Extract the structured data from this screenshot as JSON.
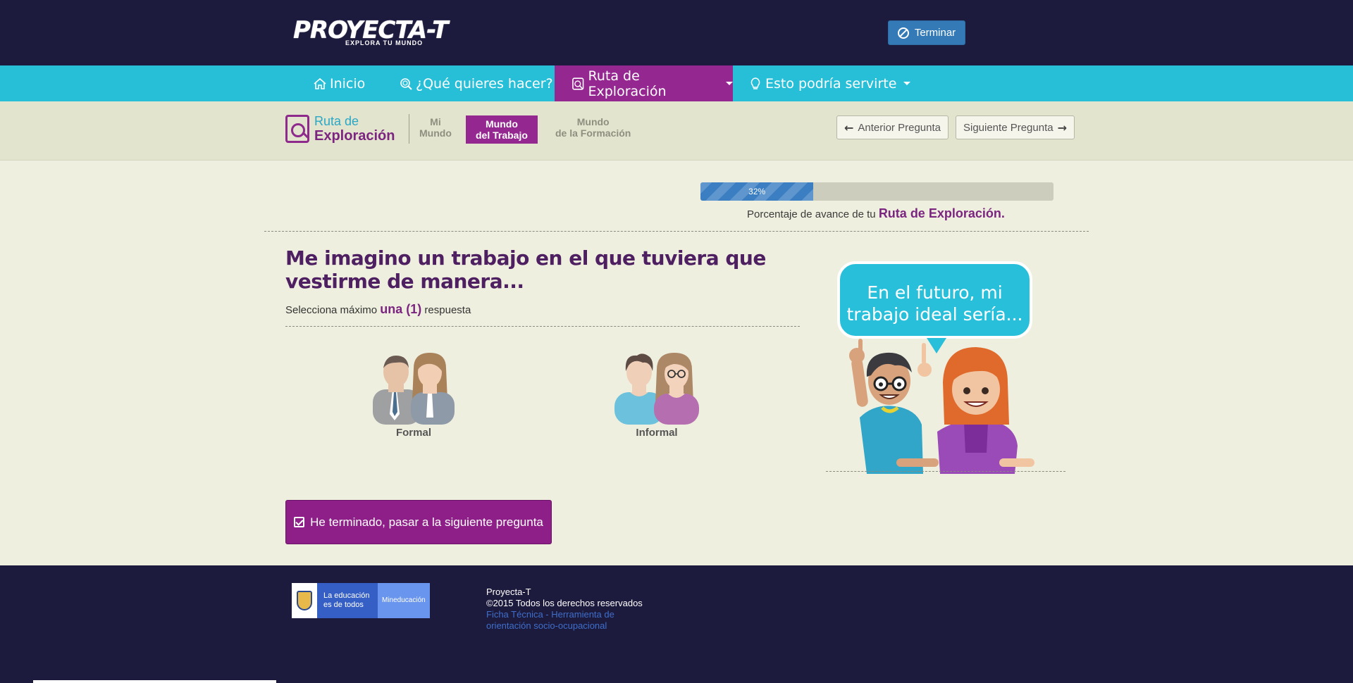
{
  "header": {
    "logo_text": "PROYECTA-T",
    "logo_tagline": "EXPLORA TU MUNDO",
    "terminar_label": "Terminar"
  },
  "nav": {
    "items": [
      {
        "label": "Inicio",
        "icon": "home-icon"
      },
      {
        "label": "¿Qué quieres hacer?",
        "icon": "search-icon"
      },
      {
        "label": "Ruta de Exploración",
        "icon": "route-icon",
        "active": true,
        "dropdown": true
      },
      {
        "label": "Esto podría servirte",
        "icon": "lightbulb-icon",
        "dropdown": true
      }
    ]
  },
  "subheader": {
    "ruta_line1": "Ruta de",
    "ruta_line2": "Exploración",
    "tabs": [
      {
        "line1": "Mi",
        "line2": "Mundo"
      },
      {
        "line1": "Mundo",
        "line2": "del Trabajo",
        "active": true
      },
      {
        "line1": "Mundo",
        "line2": "de la Formación"
      }
    ],
    "prev_label": "Anterior Pregunta",
    "next_label": "Siguiente Pregunta"
  },
  "progress": {
    "percent": 32,
    "percent_label": "32%",
    "caption_prefix": "Porcentaje de avance de tu",
    "caption_highlight": "Ruta de Exploración."
  },
  "question": {
    "title": "Me imagino un trabajo en el que tuviera que vestirme de manera...",
    "instruction_prefix": "Selecciona máximo",
    "instruction_highlight": "una (1)",
    "instruction_suffix": "respuesta",
    "options": [
      {
        "label": "Formal",
        "icon": "formal-people-icon"
      },
      {
        "label": "Informal",
        "icon": "informal-people-icon"
      }
    ]
  },
  "illustration": {
    "bubble_text": "En el futuro, mi trabajo ideal sería..."
  },
  "submit_label": "He terminado, pasar a la siguiente pregunta",
  "footer": {
    "badge_line1": "La educación",
    "badge_line2": "es de todos",
    "badge_ministry": "Mineducación",
    "site_name": "Proyecta-T",
    "copyright": "©2015 Todos los derechos reservados",
    "link_line1": "Ficha Técnica - Herramienta de",
    "link_line2": "orientación socio-ocupacional"
  },
  "colors": {
    "header_bg": "#1c1a3d",
    "nav_bg": "#27bfd8",
    "accent_purple": "#952791",
    "primary_blue": "#337ab7"
  }
}
